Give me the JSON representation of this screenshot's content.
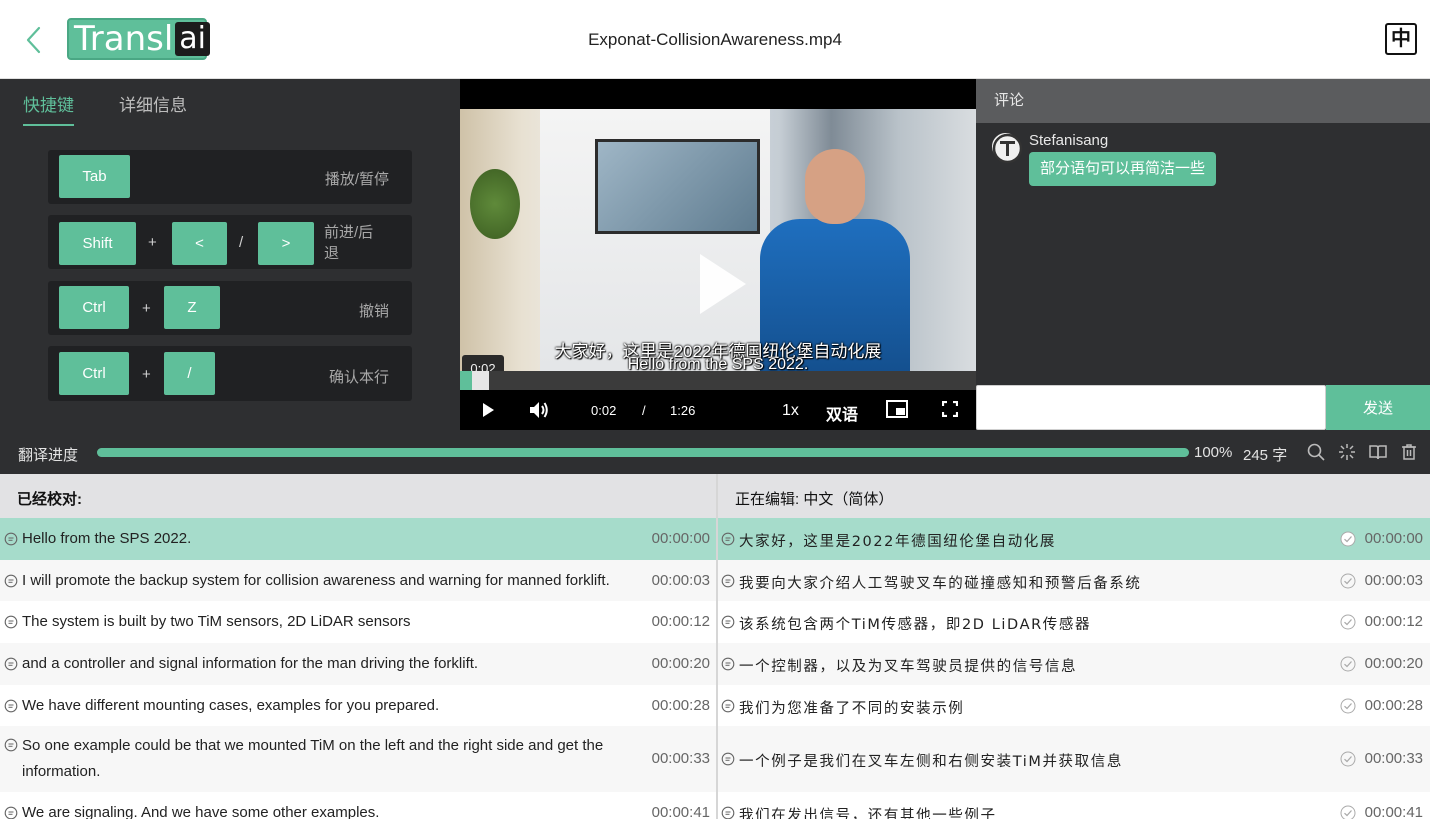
{
  "header": {
    "logo_text": "Transl",
    "logo_ai": "ai",
    "title": "Exponat-CollisionAwareness.mp4",
    "lang_toggle": "中"
  },
  "left_panel": {
    "tabs": [
      {
        "label": "快捷键",
        "active": true
      },
      {
        "label": "详细信息",
        "active": false
      }
    ],
    "shortcuts": [
      {
        "keys": [
          "Tab"
        ],
        "separators": [],
        "desc": "播放/暂停"
      },
      {
        "keys": [
          "Shift",
          "<",
          ">"
        ],
        "separators": [
          "+",
          "/"
        ],
        "desc": "前进/后退"
      },
      {
        "keys": [
          "Ctrl",
          "Z"
        ],
        "separators": [
          "+"
        ],
        "desc": "撤销"
      },
      {
        "keys": [
          "Ctrl",
          "/"
        ],
        "separators": [
          "+"
        ],
        "desc": "确认本行"
      }
    ]
  },
  "video": {
    "current_bubble": "0:02",
    "subtitle_zh": "大家好，这里是2022年德国纽伦堡自动化展",
    "subtitle_en": "Hello from the SPS 2022.",
    "current_time": "0:02",
    "time_sep": "/",
    "duration": "1:26",
    "played_fraction": 0.023,
    "speed": "1x",
    "subtitle_mode": "双语"
  },
  "comments": {
    "header": "评论",
    "items": [
      {
        "user": "Stefanisang",
        "text": "部分语句可以再简洁一些",
        "avatar_letter": "T"
      }
    ],
    "input_placeholder": "",
    "send_label": "发送"
  },
  "progress": {
    "label": "翻译进度",
    "percent_value": 100,
    "percent": "100%",
    "count": "245 字",
    "icons": [
      "search-icon",
      "magic-wand-icon",
      "book-icon",
      "trash-icon"
    ]
  },
  "table": {
    "left_header": "已经校对:",
    "right_header": "正在编辑:  中文（简体）",
    "rows": [
      {
        "src": "Hello from the SPS 2022.",
        "src_time": "00:00:00",
        "tgt": "大家好，这里是2022年德国纽伦堡自动化展",
        "tgt_time": "00:00:00",
        "highlight": true
      },
      {
        "src": "I will promote the backup system for collision awareness and warning for manned forklift.",
        "src_time": "00:00:03",
        "tgt": "我要向大家介绍人工驾驶叉车的碰撞感知和预警后备系统",
        "tgt_time": "00:00:03",
        "highlight": false
      },
      {
        "src": "The system is built by two TiM sensors, 2D LiDAR sensors",
        "src_time": "00:00:12",
        "tgt": "该系统包含两个TiM传感器，即2D LiDAR传感器",
        "tgt_time": "00:00:12",
        "highlight": false
      },
      {
        "src": "and a controller and signal information for the man driving the forklift.",
        "src_time": "00:00:20",
        "tgt": "一个控制器，以及为叉车驾驶员提供的信号信息",
        "tgt_time": "00:00:20",
        "highlight": false
      },
      {
        "src": "We have different mounting cases, examples for you prepared.",
        "src_time": "00:00:28",
        "tgt": "我们为您准备了不同的安装示例",
        "tgt_time": "00:00:28",
        "highlight": false
      },
      {
        "src": "So one example could be that we mounted TiM on the left and the right side and get the information.",
        "src_time": "00:00:33",
        "tgt": "一个例子是我们在叉车左侧和右侧安装TiM并获取信息",
        "tgt_time": "00:00:33",
        "highlight": false
      },
      {
        "src": "We are signaling. And we have some other examples.",
        "src_time": "00:00:41",
        "tgt": "我们在发出信号，还有其他一些例子",
        "tgt_time": "00:00:41",
        "highlight": false
      }
    ]
  },
  "colors": {
    "accent": "#5fbf9a",
    "dark_panel": "#2e2f31",
    "highlight_row": "#a6dccb"
  }
}
